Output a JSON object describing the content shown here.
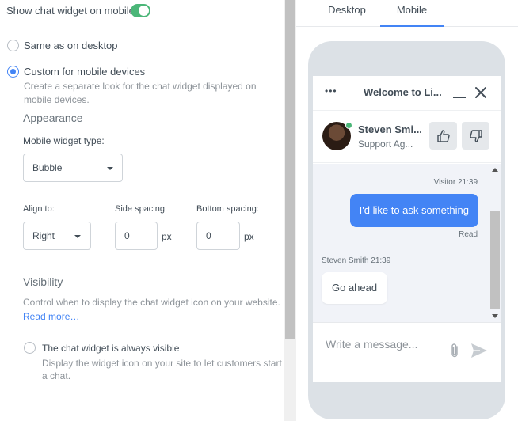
{
  "settings": {
    "show_mobile_label": "Show chat widget on mobile",
    "show_mobile_enabled": true,
    "options": {
      "same_label": "Same as on desktop",
      "custom_label": "Custom for mobile devices",
      "custom_desc_line1": "Create a separate look for the chat widget displayed on",
      "custom_desc_line2": "mobile devices."
    },
    "appearance": {
      "title": "Appearance",
      "widget_type_label": "Mobile widget type:",
      "widget_type_value": "Bubble",
      "align_label": "Align to:",
      "align_value": "Right",
      "side_spacing_label": "Side spacing:",
      "side_spacing_value": "0",
      "bottom_spacing_label": "Bottom spacing:",
      "bottom_spacing_value": "0",
      "unit": "px"
    },
    "visibility": {
      "title": "Visibility",
      "desc": "Control when to display the chat widget icon on your website.",
      "read_more": "Read more…",
      "always_visible_label": "The chat widget is always visible",
      "always_visible_desc_line1": "Display the widget icon on your site to let customers start",
      "always_visible_desc_line2": "a chat."
    }
  },
  "preview": {
    "tabs": [
      {
        "label": "Desktop",
        "active": false
      },
      {
        "label": "Mobile",
        "active": true
      }
    ],
    "chat": {
      "menu_dots": "•••",
      "header_title": "Welcome to Li...",
      "agent_name": "Steven Smi...",
      "agent_role": "Support Ag...",
      "visitor_meta": "Visitor 21:39",
      "visitor_message": "I'd like to ask something",
      "read_status": "Read",
      "agent_meta": "Steven Smith 21:39",
      "agent_message": "Go ahead",
      "composer_placeholder": "Write a message..."
    }
  },
  "colors": {
    "accent": "#4384f5",
    "toggle_on": "#4bb678",
    "online": "#4bb678"
  }
}
